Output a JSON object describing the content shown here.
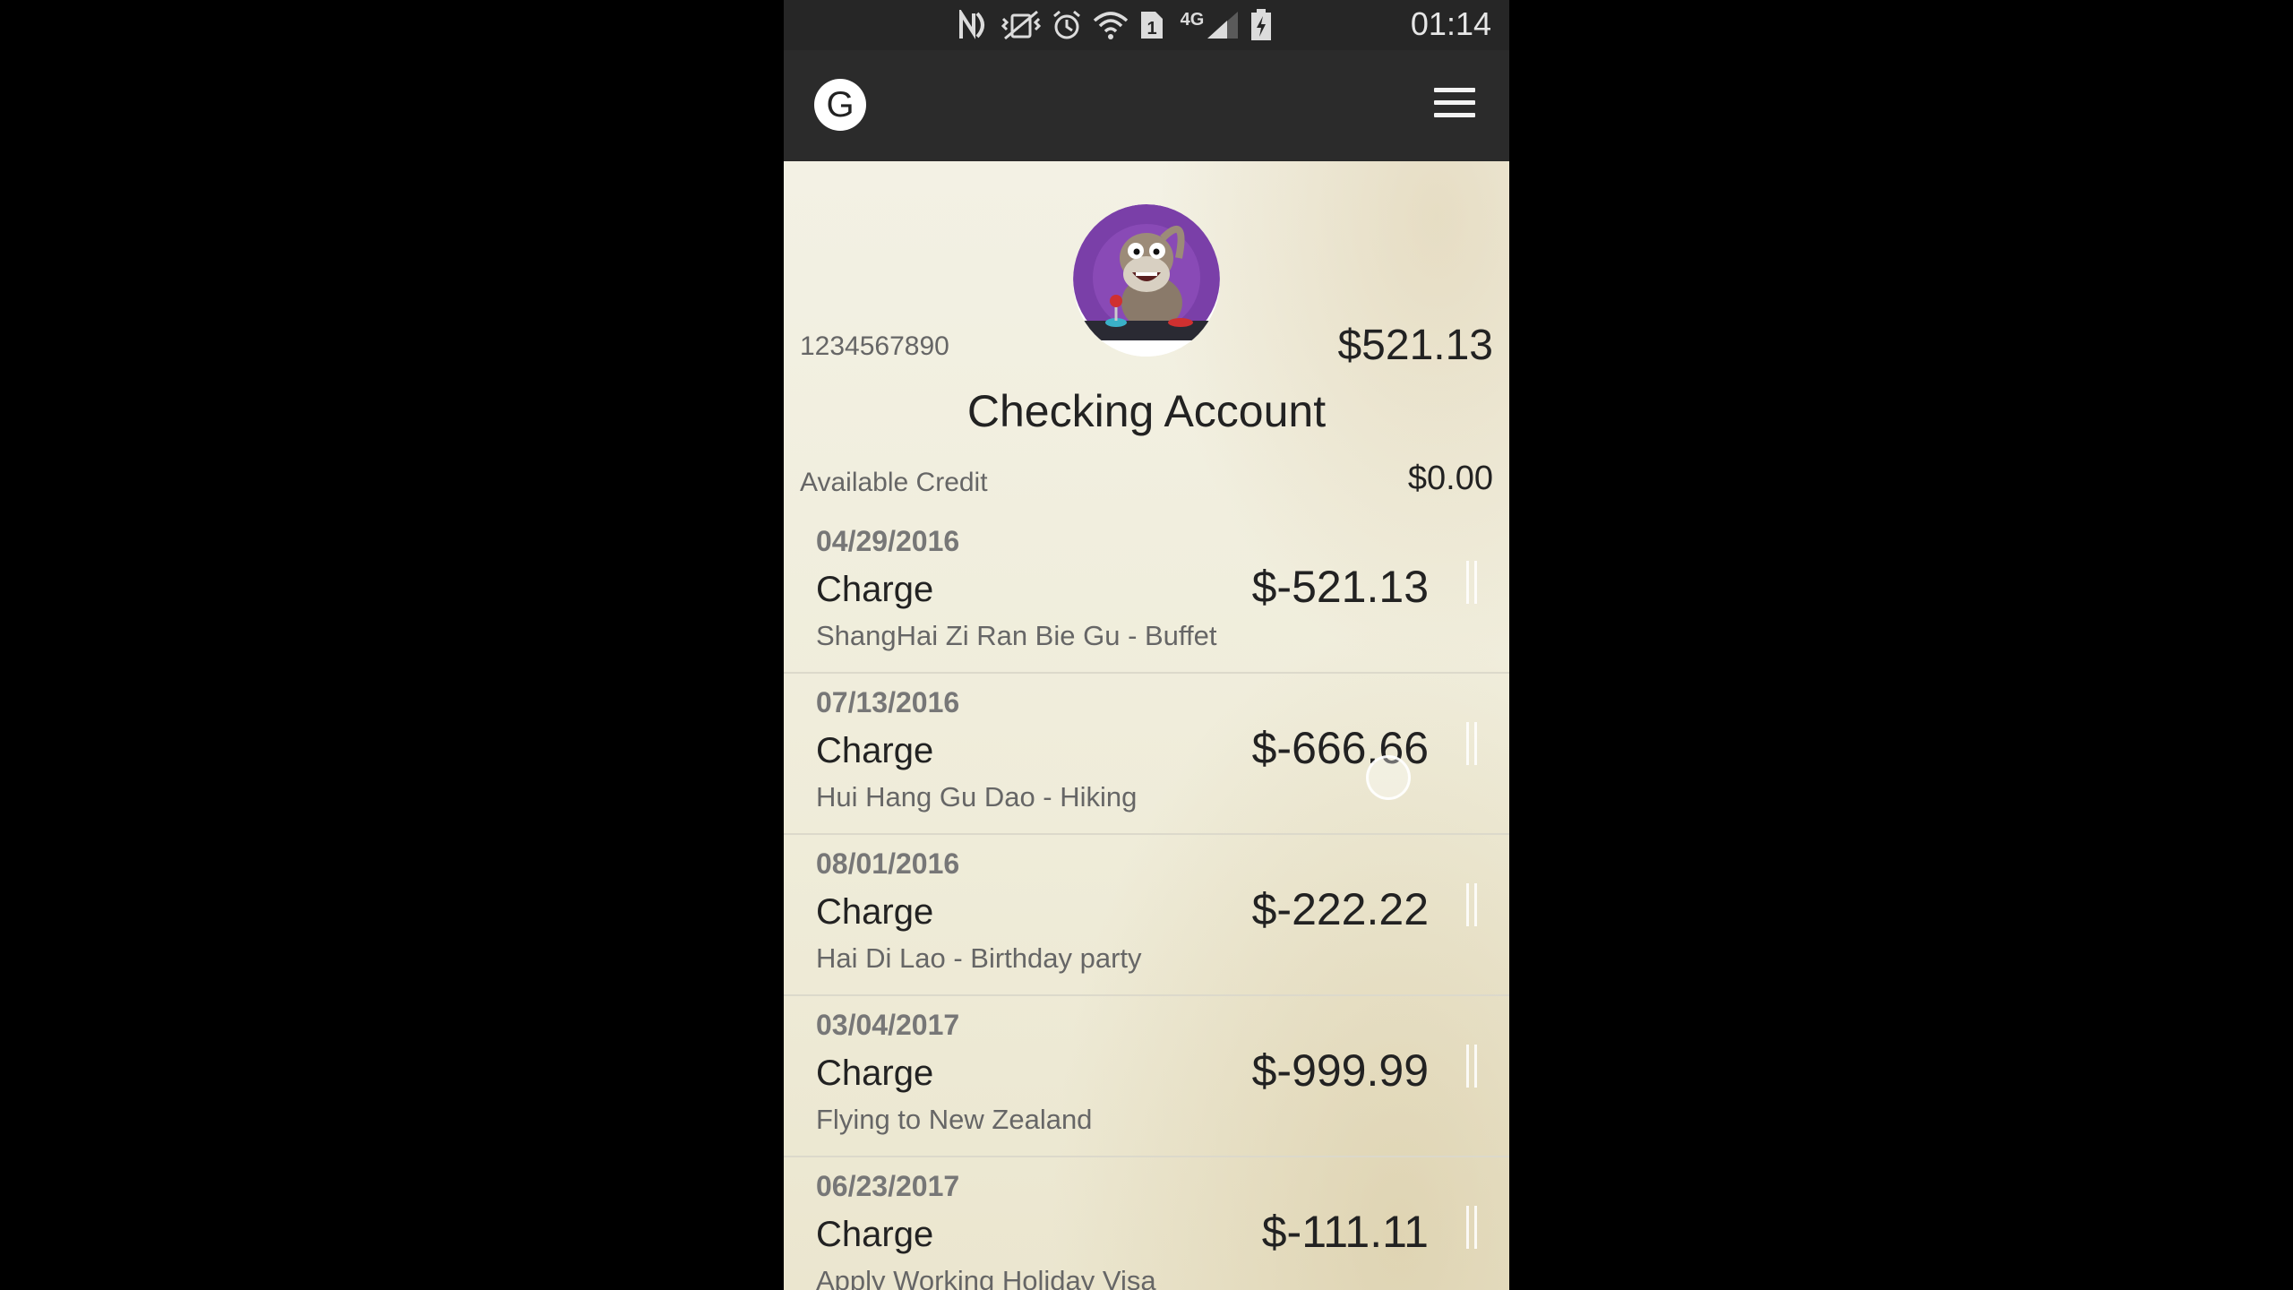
{
  "status_bar": {
    "time": "01:14",
    "network": "4G",
    "icons": [
      "nfc-icon",
      "vibrate-icon",
      "alarm-icon",
      "wifi-icon",
      "sim-1-icon",
      "signal-icon",
      "battery-charging-icon"
    ]
  },
  "app_bar": {
    "logo_letter": "G",
    "menu_icon": "hamburger-menu-icon"
  },
  "account": {
    "number": "1234567890",
    "balance": "$521.13",
    "title": "Checking Account",
    "credit_label": "Available Credit",
    "credit_value": "$0.00"
  },
  "transactions": [
    {
      "date": "04/29/2016",
      "type": "Charge",
      "amount": "$-521.13",
      "description": "ShangHai Zi Ran Bie Gu - Buffet"
    },
    {
      "date": "07/13/2016",
      "type": "Charge",
      "amount": "$-666.66",
      "description": "Hui Hang Gu Dao - Hiking"
    },
    {
      "date": "08/01/2016",
      "type": "Charge",
      "amount": "$-222.22",
      "description": "Hai Di Lao - Birthday party"
    },
    {
      "date": "03/04/2017",
      "type": "Charge",
      "amount": "$-999.99",
      "description": "Flying to New Zealand"
    },
    {
      "date": "06/23/2017",
      "type": "Charge",
      "amount": "$-111.11",
      "description": "Apply Working Holiday Visa"
    }
  ],
  "colors": {
    "status_bar_bg": "#262626",
    "app_bar_bg": "#2b2b2b",
    "content_bg": "#f1eddc",
    "avatar_purple": "#7a3fa8"
  }
}
